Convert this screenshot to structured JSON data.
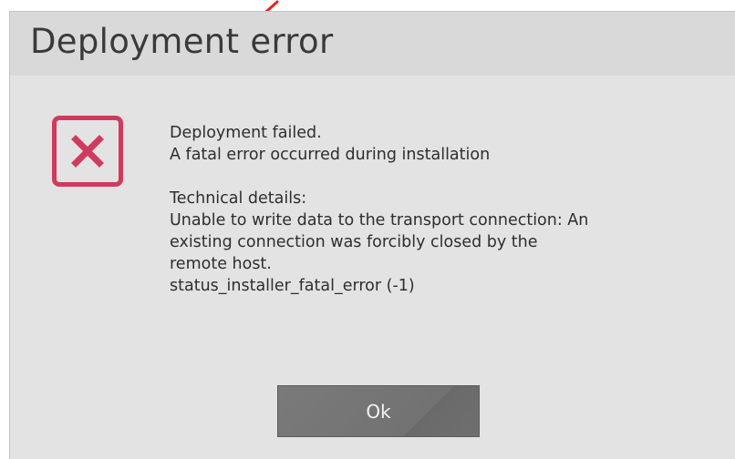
{
  "dialog": {
    "title": "Deployment error",
    "icon": "error-x-icon",
    "message_lines": [
      "Deployment failed.",
      "A fatal error occurred during installation"
    ],
    "details_lines": [
      "Technical details:",
      "Unable to write data to the transport connection: An",
      "existing connection was forcibly closed by the",
      "remote host.",
      "status_installer_fatal_error (-1)"
    ],
    "ok_label": "Ok"
  },
  "colors": {
    "dialog_bg": "#e3e3e3",
    "title_bg": "#d9d9d9",
    "error_accent": "#d13a5f",
    "button_bg": "#747474",
    "annotation_arrow": "#e8231f"
  }
}
